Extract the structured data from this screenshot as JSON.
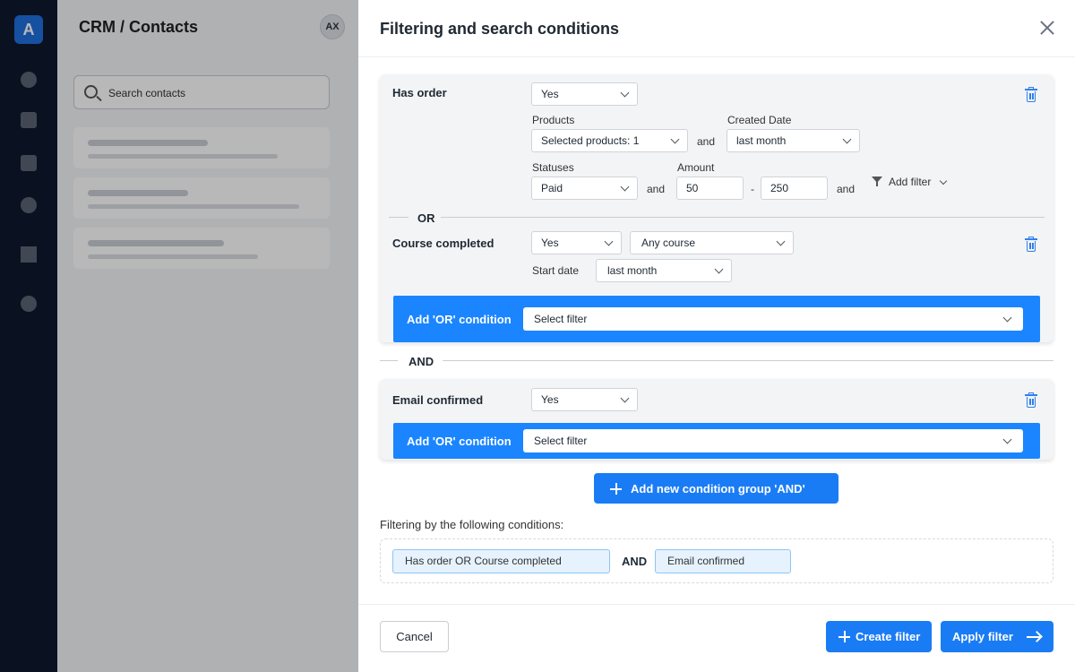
{
  "app": {
    "logo_letter": "A",
    "page_title": "CRM / Contacts",
    "avatar_initials": "AX",
    "search_placeholder": "Search contacts"
  },
  "modal": {
    "title": "Filtering and search conditions",
    "group1": {
      "conditions": {
        "has_order": {
          "label": "Has order",
          "value": "Yes",
          "products_label": "Products",
          "products_value": "Selected products: 1",
          "created_label": "Created Date",
          "created_value": "last month",
          "statuses_label": "Statuses",
          "statuses_value": "Paid",
          "amount_label": "Amount",
          "amount_min": "50",
          "amount_max": "250",
          "range_sep": "-",
          "add_filter": "Add filter"
        },
        "course_completed": {
          "label": "Course completed",
          "value": "Yes",
          "course_value": "Any course",
          "start_date_label": "Start date",
          "start_date_value": "last month"
        }
      },
      "or_divider": "OR",
      "add_or": {
        "label": "Add 'OR' condition",
        "placeholder": "Select filter"
      }
    },
    "and_divider": "AND",
    "group2": {
      "email_confirmed": {
        "label": "Email confirmed",
        "value": "Yes"
      },
      "add_or": {
        "label": "Add 'OR' condition",
        "placeholder": "Select filter"
      }
    },
    "add_group_button": "Add new condition group 'AND'",
    "connector_and": "and",
    "summary": {
      "label": "Filtering by the following conditions:",
      "chip1": "Has order OR Course completed",
      "joiner": "AND",
      "chip2": "Email confirmed"
    },
    "footer": {
      "cancel": "Cancel",
      "create": "Create filter",
      "apply": "Apply filter"
    }
  },
  "colors": {
    "accent": "#1a7cf5",
    "or_bar": "#1a85ff",
    "nav_rail": "#0f1a2e",
    "trash": "#2f80ed"
  }
}
